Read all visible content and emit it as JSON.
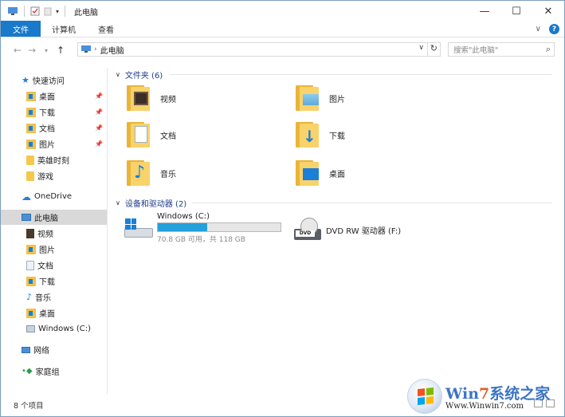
{
  "window": {
    "title": "此电脑"
  },
  "ribbon": {
    "tabs": [
      "文件",
      "计算机",
      "查看"
    ]
  },
  "controls": {
    "minimize": "—",
    "maximize": "☐",
    "close": "✕",
    "expand": "∨",
    "help": "?"
  },
  "address": {
    "path": "此电脑",
    "search_placeholder": "搜索\"此电脑\""
  },
  "sidebar": {
    "quick_access": "快速访问",
    "quick_items": [
      {
        "label": "桌面",
        "pinned": true
      },
      {
        "label": "下载",
        "pinned": true
      },
      {
        "label": "文档",
        "pinned": true
      },
      {
        "label": "图片",
        "pinned": true
      },
      {
        "label": "英雄时刻",
        "pinned": false
      },
      {
        "label": "游戏",
        "pinned": false
      }
    ],
    "onedrive": "OneDrive",
    "this_pc": "此电脑",
    "pc_items": [
      "视频",
      "图片",
      "文档",
      "下载",
      "音乐",
      "桌面",
      "Windows (C:)"
    ],
    "network": "网络",
    "homegroup": "家庭组"
  },
  "content": {
    "folders_header": "文件夹 (6)",
    "folders": [
      "视频",
      "图片",
      "文档",
      "下载",
      "音乐",
      "桌面"
    ],
    "devices_header": "设备和驱动器 (2)",
    "drive_c": {
      "name": "Windows (C:)",
      "space": "70.8 GB 可用，共 118 GB",
      "used_fraction": 0.4
    },
    "drive_f": {
      "name": "DVD RW 驱动器 (F:)"
    }
  },
  "status": {
    "count": "8 个项目"
  },
  "watermark": {
    "brand_a": "Win",
    "brand_b": "7",
    "brand_c": "系统之家",
    "url": "Www.Winwin7.com"
  },
  "colors": {
    "accent": "#1979ca",
    "folder": "#f5c84c",
    "progress": "#26a0da"
  }
}
